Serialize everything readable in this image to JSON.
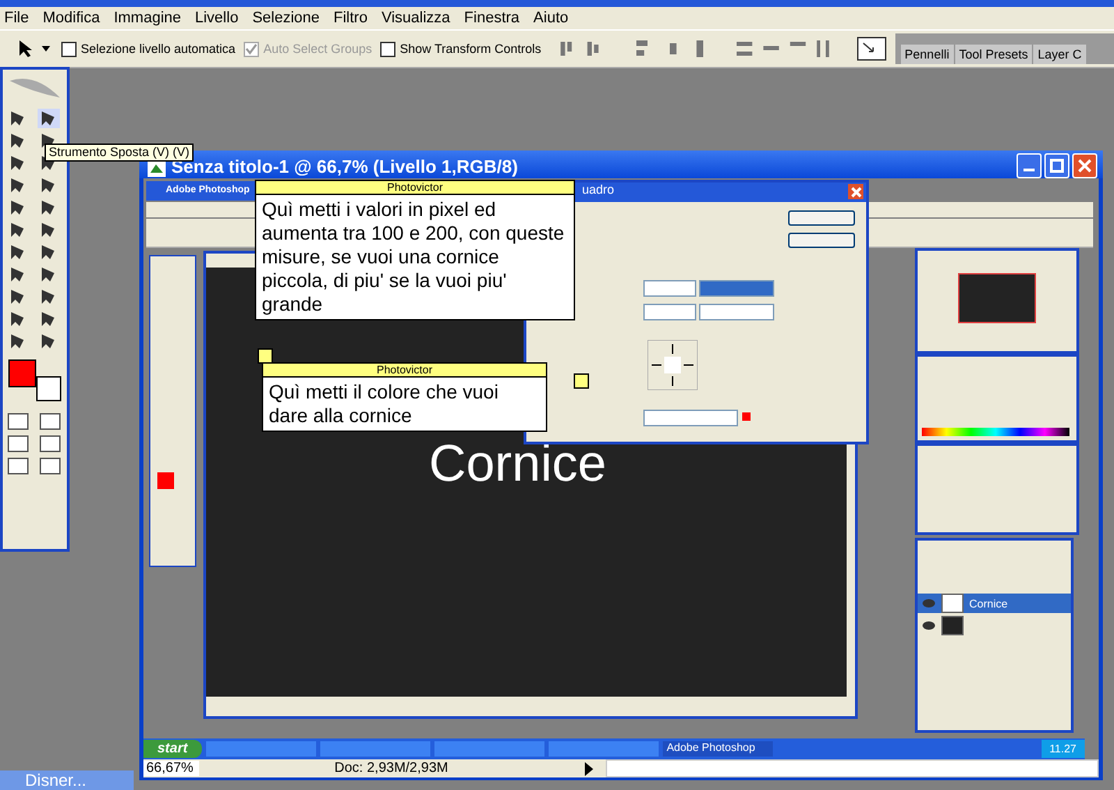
{
  "menu": [
    "File",
    "Modifica",
    "Immagine",
    "Livello",
    "Selezione",
    "Filtro",
    "Visualizza",
    "Finestra",
    "Aiuto"
  ],
  "options_bar": {
    "checkboxes": [
      {
        "label": "Selezione livello automatica",
        "checked": false,
        "disabled": false
      },
      {
        "label": "Auto Select Groups",
        "checked": true,
        "disabled": true
      },
      {
        "label": "Show Transform Controls",
        "checked": false,
        "disabled": false
      }
    ],
    "palette_tabs": [
      "Pennelli",
      "Tool Presets",
      "Layer C"
    ]
  },
  "toolbox": {
    "tooltip": "Strumento Sposta (V) (V)"
  },
  "document": {
    "title": "Senza titolo-1 @ 66,7% (Livello 1,RGB/8)",
    "zoom": "66,67%",
    "doc_info": "Doc: 2,93M/2,93M"
  },
  "inner": {
    "app_title": "Adobe Photoshop",
    "canvas_text": "Cornice",
    "dialog_title": "uadro",
    "layers": [
      {
        "name": "Cornice",
        "kind": "text",
        "selected": true
      },
      {
        "kind": "image",
        "selected": false
      }
    ]
  },
  "notes": [
    {
      "title": "Photovictor",
      "text": "Quì metti i valori in pixel ed aumenta tra 100 e 200, con queste misure, se vuoi una cornice piccola, di piu' se la vuoi piu' grande"
    },
    {
      "title": "Photovictor",
      "text": "Quì metti il colore che vuoi dare alla cornice"
    }
  ],
  "taskbar": {
    "start": "start",
    "tasks": [
      {
        "selected": false
      },
      {
        "selected": false
      },
      {
        "selected": false
      },
      {
        "selected": false
      },
      {
        "label": "Adobe Photoshop",
        "selected": true
      }
    ],
    "clock": "11.27"
  },
  "minimized_window": {
    "title": "Disner..."
  }
}
